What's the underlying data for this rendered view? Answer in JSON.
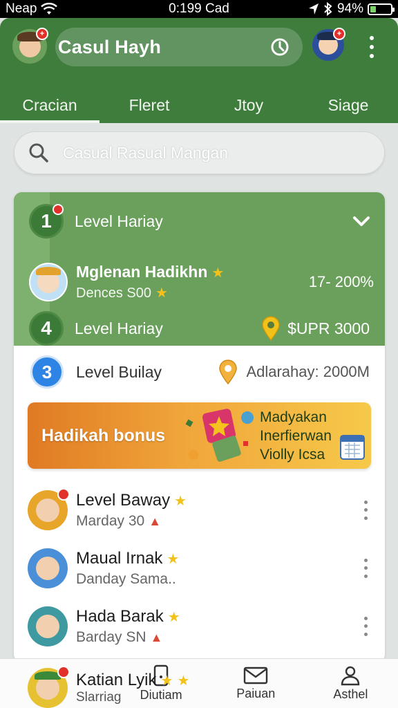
{
  "status_bar": {
    "carrier": "Neap",
    "time": "0:199 Cad",
    "battery": "94%",
    "battery_level": 0.3
  },
  "header": {
    "title": "Casul Hayh"
  },
  "tabs": [
    {
      "label": "Cracian",
      "active": true
    },
    {
      "label": "Fleret",
      "active": false
    },
    {
      "label": "Jtoy",
      "active": false
    },
    {
      "label": "Siage",
      "active": false
    }
  ],
  "search": {
    "placeholder": "Casual Rasual Mangan"
  },
  "leaderboard": {
    "row1": {
      "rank": "1",
      "label": "Level Hariay"
    },
    "player": {
      "name": "Mglenan Hadikhn",
      "sub": "Dences S00",
      "percent": "17- 200%"
    },
    "row4": {
      "rank": "4",
      "label": "Level Hariay",
      "prize": "$UPR 3000"
    },
    "row3": {
      "rank": "3",
      "label": "Level Builay",
      "value": "Adlarahay: 2000M"
    }
  },
  "banner": {
    "title": "Hadikah bonus",
    "lines": [
      "Madyakan",
      "Inerfierwan",
      "Violly Icsa"
    ]
  },
  "list": [
    {
      "name": "Level Baway",
      "sub": "Marday 30",
      "avatar_color": "#e7a52a"
    },
    {
      "name": "Maual Irnak",
      "sub": "Danday Sama..",
      "avatar_color": "#4a8fd8"
    },
    {
      "name": "Hada Barak",
      "sub": "Barday SN",
      "avatar_color": "#3e9aa0"
    }
  ],
  "bottom_overlay": {
    "name": "Katian Lyik",
    "sub": "Slarriag"
  },
  "bottom_nav": [
    {
      "label": "Diutiam",
      "icon": "phone-icon"
    },
    {
      "label": "Paiuan",
      "icon": "mail-icon"
    },
    {
      "label": "Asthel",
      "icon": "person-icon"
    }
  ],
  "colors": {
    "primary_green": "#3f7d3d",
    "card_green": "#6a9f5c",
    "accent_blue": "#2d84e4",
    "star": "#f2c21b"
  }
}
